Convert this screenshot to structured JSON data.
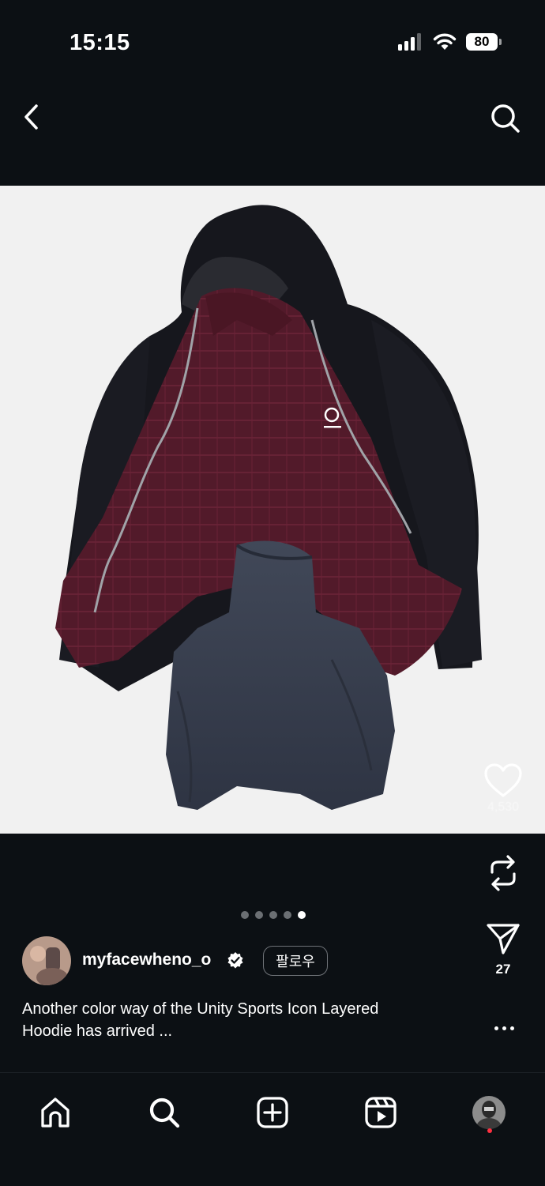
{
  "status_bar": {
    "time": "15:15",
    "battery": "80",
    "icons": [
      "cellular-signal-icon",
      "wifi-icon",
      "battery-icon"
    ]
  },
  "header": {
    "back_icon": "chevron-left-icon",
    "search_icon": "search-icon"
  },
  "post": {
    "media_description": "flat-lay product photo of layered hoodie",
    "likes": "4,530",
    "shares": "27",
    "carousel": {
      "total": 5,
      "active": 5
    },
    "author": {
      "username": "myfacewheno_o",
      "verified": true
    },
    "follow_label": "팔로우",
    "caption_line1": "Another color way of the Unity Sports Icon Layered",
    "caption_line2": "Hoodie has arrived ..."
  },
  "bottom_nav": {
    "items": [
      "home-icon",
      "search-icon",
      "create-icon",
      "reels-icon",
      "profile-avatar"
    ]
  },
  "colors": {
    "background": "#0c1014",
    "media_background": "#f1f1f1",
    "notification_dot": "#ff3040",
    "verified_badge": "#ffffff"
  }
}
